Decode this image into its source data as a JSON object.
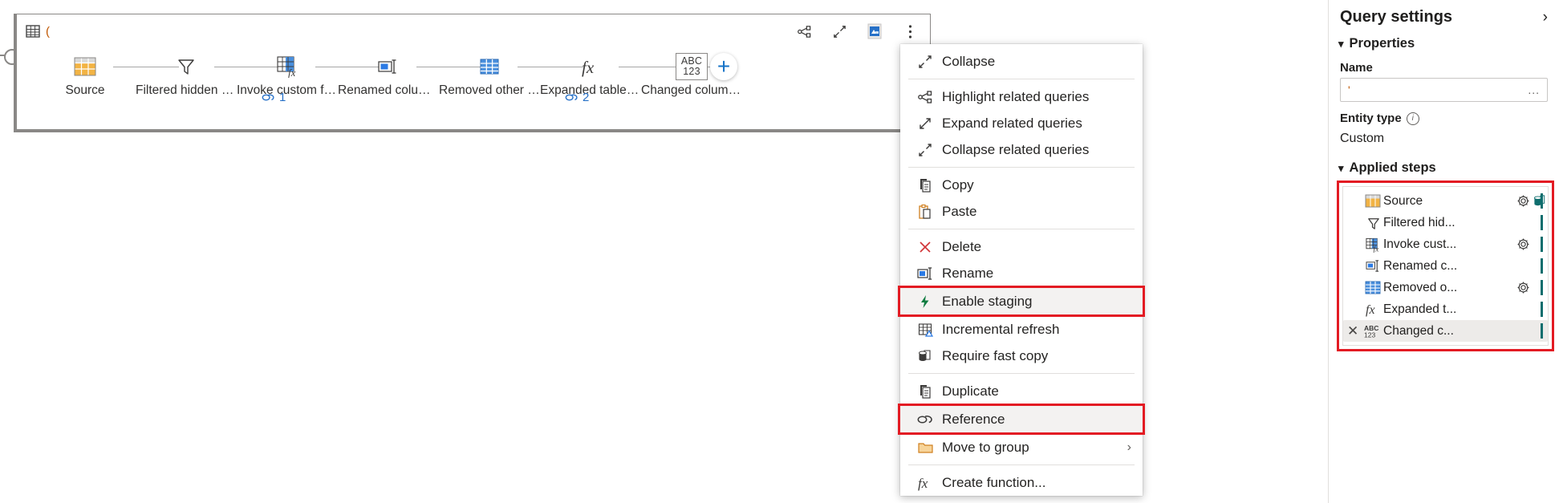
{
  "diagram": {
    "card_title": "(",
    "table_icon": "table-icon",
    "toolbar": [
      {
        "name": "highlight-related-queries-icon",
        "label": "Highlight related queries"
      },
      {
        "name": "collapse-icon",
        "label": "Collapse"
      },
      {
        "name": "query-data-preview-icon",
        "label": "Data preview"
      },
      {
        "name": "more-options-icon",
        "label": "More options"
      }
    ],
    "steps": [
      {
        "label": "Source",
        "icon": "source-table-icon",
        "badge": null
      },
      {
        "label": "Filtered hidden fi...",
        "icon": "filter-icon",
        "badge": null
      },
      {
        "label": "Invoke custom fu...",
        "icon": "invoke-function-icon",
        "badge": "1"
      },
      {
        "label": "Renamed columns",
        "icon": "rename-columns-icon",
        "badge": null
      },
      {
        "label": "Removed other c...",
        "icon": "removed-columns-icon",
        "badge": null
      },
      {
        "label": "Expanded table c...",
        "icon": "fx-icon",
        "badge": "2"
      },
      {
        "label": "Changed column...",
        "icon": "abc123-icon",
        "badge": null
      }
    ],
    "add_step_label": "+"
  },
  "context_menu": {
    "groups": [
      {
        "items": [
          {
            "label": "Collapse",
            "icon": "collapse-icon",
            "highlighted": false,
            "submenu": false
          }
        ]
      },
      {
        "items": [
          {
            "label": "Highlight related queries",
            "icon": "highlight-related-queries-icon",
            "highlighted": false,
            "submenu": false
          },
          {
            "label": "Expand related queries",
            "icon": "expand-related-queries-icon",
            "highlighted": false,
            "submenu": false
          },
          {
            "label": "Collapse related queries",
            "icon": "collapse-related-queries-icon",
            "highlighted": false,
            "submenu": false
          }
        ]
      },
      {
        "items": [
          {
            "label": "Copy",
            "icon": "copy-icon",
            "highlighted": false,
            "submenu": false
          },
          {
            "label": "Paste",
            "icon": "paste-icon",
            "highlighted": false,
            "submenu": false
          }
        ]
      },
      {
        "items": [
          {
            "label": "Delete",
            "icon": "delete-x-icon",
            "highlighted": false,
            "submenu": false
          },
          {
            "label": "Rename",
            "icon": "rename-icon",
            "highlighted": false,
            "submenu": false
          },
          {
            "label": "Enable staging",
            "icon": "lightning-bolt-icon",
            "highlighted": true,
            "submenu": false
          },
          {
            "label": "Incremental refresh",
            "icon": "incremental-refresh-icon",
            "highlighted": false,
            "submenu": false
          },
          {
            "label": "Require fast copy",
            "icon": "fast-copy-icon",
            "highlighted": false,
            "submenu": false
          }
        ]
      },
      {
        "items": [
          {
            "label": "Duplicate",
            "icon": "duplicate-icon",
            "highlighted": false,
            "submenu": false
          },
          {
            "label": "Reference",
            "icon": "reference-link-icon",
            "highlighted": true,
            "submenu": false
          },
          {
            "label": "Move to group",
            "icon": "folder-icon",
            "highlighted": false,
            "submenu": true
          }
        ]
      },
      {
        "items": [
          {
            "label": "Create function...",
            "icon": "fx-icon",
            "highlighted": false,
            "submenu": false
          }
        ]
      }
    ],
    "submenu_arrow": "›"
  },
  "query_settings": {
    "title": "Query settings",
    "expand_icon": "›",
    "properties": {
      "section_label": "Properties",
      "chevron": "⌄",
      "name_label": "Name",
      "name_value": "'",
      "name_ellipsis": "...",
      "entity_type_label": "Entity type",
      "entity_type_info_icon": "info-icon",
      "entity_type_value": "Custom"
    },
    "applied_steps": {
      "section_label": "Applied steps",
      "chevron": "⌄",
      "steps": [
        {
          "label": "Source",
          "icon": "source-table-icon",
          "gear": true,
          "database": true,
          "selected": false,
          "delete": false
        },
        {
          "label": "Filtered hid...",
          "icon": "filter-icon",
          "gear": false,
          "database": false,
          "selected": false,
          "delete": false
        },
        {
          "label": "Invoke cust...",
          "icon": "invoke-function-icon",
          "gear": true,
          "database": false,
          "selected": false,
          "delete": false
        },
        {
          "label": "Renamed c...",
          "icon": "rename-icon",
          "gear": false,
          "database": false,
          "selected": false,
          "delete": false
        },
        {
          "label": "Removed o...",
          "icon": "removed-columns-icon",
          "gear": true,
          "database": false,
          "selected": false,
          "delete": false
        },
        {
          "label": "Expanded t...",
          "icon": "fx-icon",
          "gear": false,
          "database": false,
          "selected": false,
          "delete": false
        },
        {
          "label": "Changed c...",
          "icon": "abc123-icon",
          "gear": false,
          "database": false,
          "selected": true,
          "delete": true
        }
      ]
    }
  },
  "colors": {
    "highlight_red": "#e31b23",
    "accent_blue": "#2670c7",
    "orange": "#c05600",
    "teal": "#0f6e6e",
    "green": "#107c41"
  }
}
